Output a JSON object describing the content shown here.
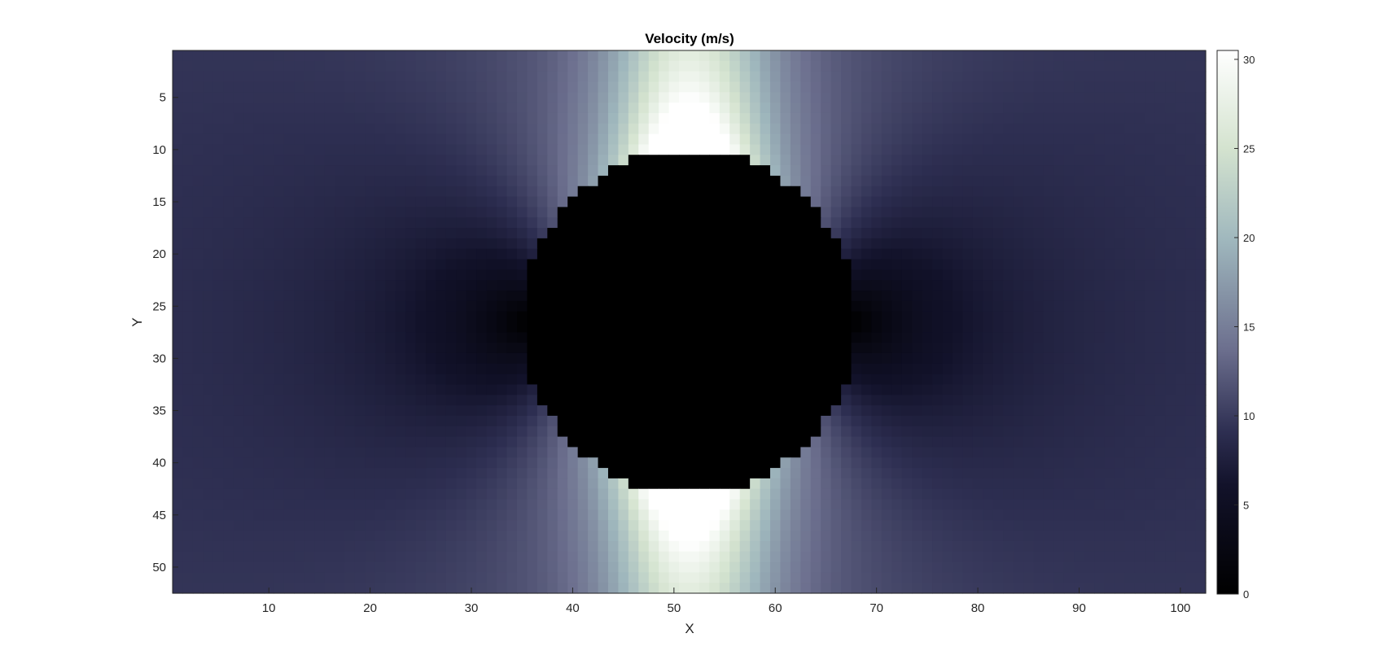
{
  "chart_data": {
    "type": "heatmap",
    "title": "Velocity (m/s)",
    "xlabel": "X",
    "ylabel": "Y",
    "xlim": [
      0.5,
      102.5
    ],
    "ylim": [
      0.5,
      52.5
    ],
    "y_reversed": true,
    "grid_cols": 102,
    "grid_rows": 52,
    "xticks": [
      10,
      20,
      30,
      40,
      50,
      60,
      70,
      80,
      90,
      100
    ],
    "yticks": [
      5,
      10,
      15,
      20,
      25,
      30,
      35,
      40,
      45,
      50
    ],
    "colorbar": {
      "min": 0,
      "max": 30.5,
      "ticks": [
        0,
        5,
        10,
        15,
        20,
        25,
        30
      ],
      "colormap": "bone-like",
      "colors": [
        "#000000",
        "#12122a",
        "#2e2f52",
        "#6c6f8e",
        "#9fb7bd",
        "#d4e3cf",
        "#ffffff"
      ],
      "stops": [
        0,
        0.2,
        0.3,
        0.45,
        0.65,
        0.82,
        1
      ]
    },
    "freestream_velocity": 10,
    "obstacle": {
      "shape": "circle",
      "center_x": 51.5,
      "center_y": 26.5,
      "radius": 16.5,
      "value": 0
    },
    "peak_velocity": 30.5
  }
}
